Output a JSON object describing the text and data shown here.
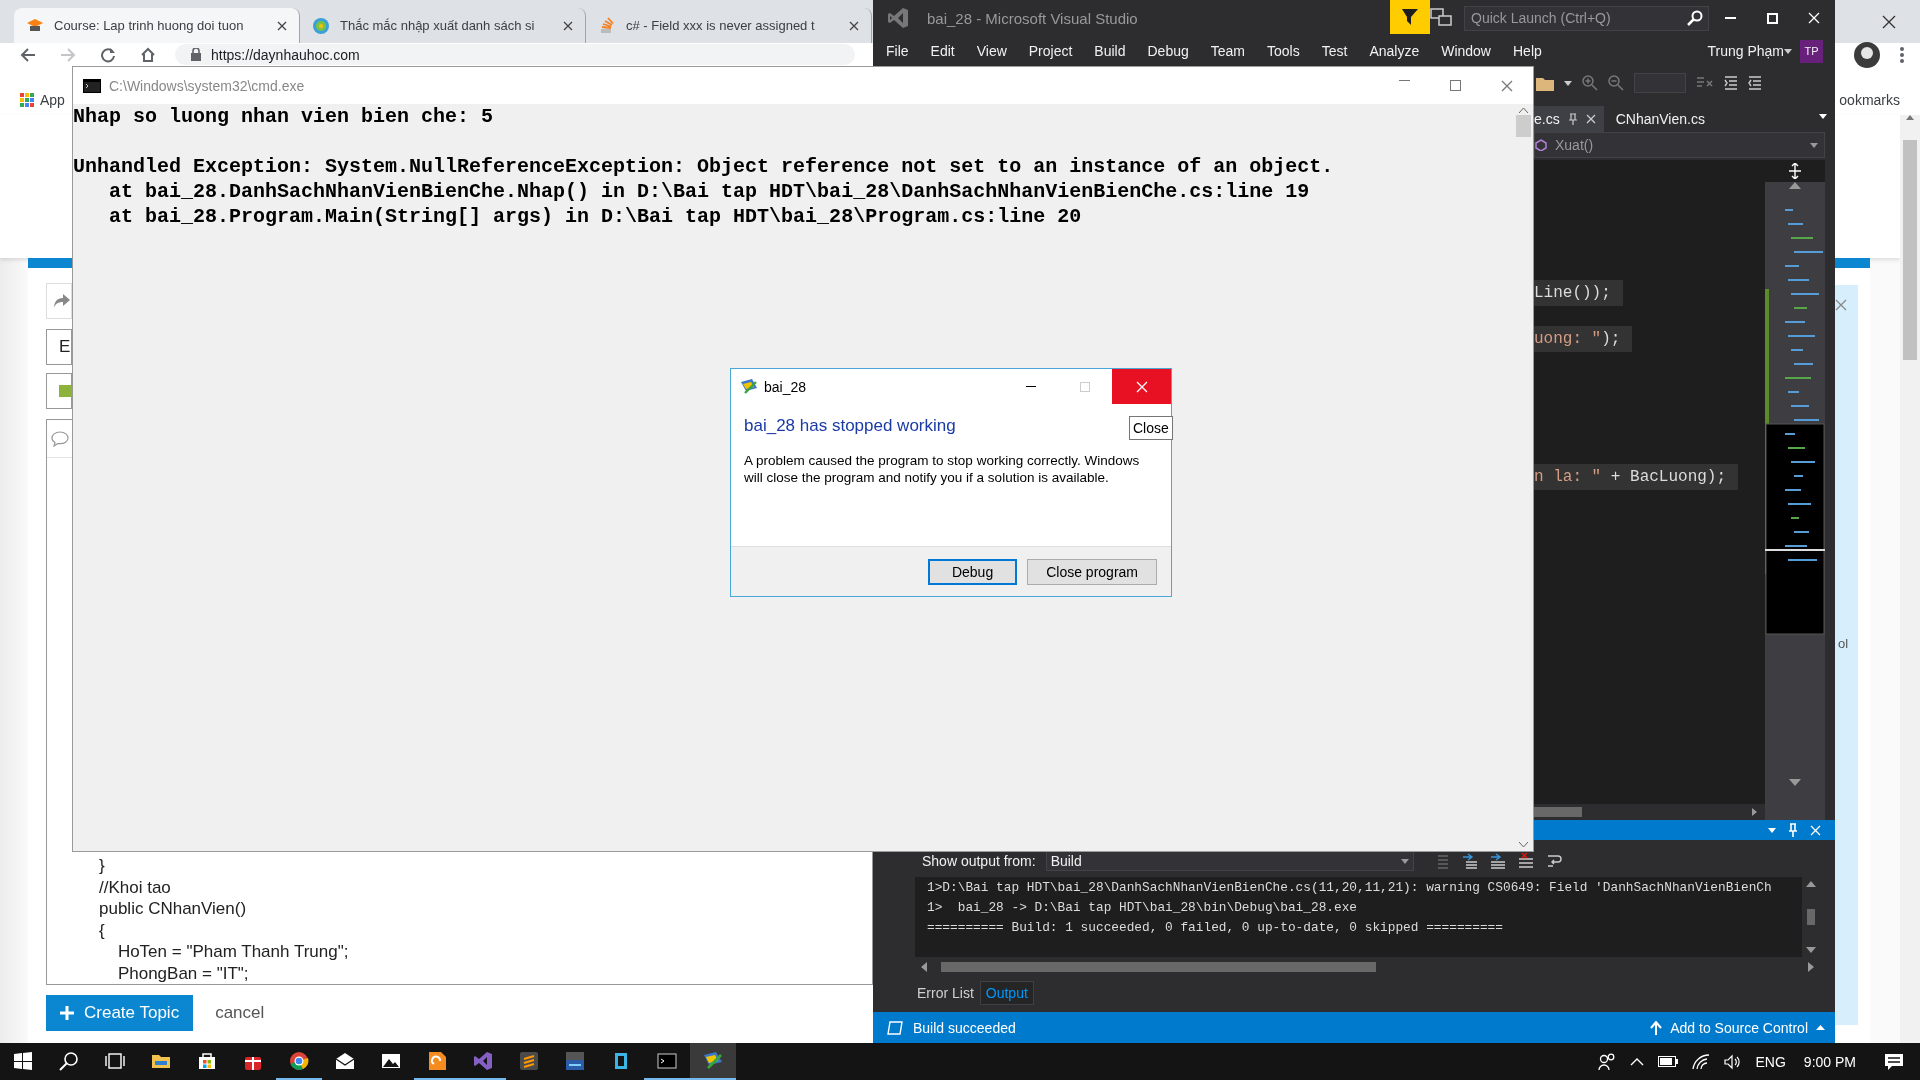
{
  "browser": {
    "tabs": [
      {
        "title": "Course: Lap trinh huong doi tuon",
        "selected": true
      },
      {
        "title": "Thắc mắc nhập xuất danh sách si",
        "selected": false
      },
      {
        "title": "c# - Field xxx is never assigned t",
        "selected": false
      }
    ],
    "address": "https://daynhauhoc.com",
    "bookmarks": [
      "App"
    ],
    "other_bookmarks": "ookmarks",
    "form": {
      "field_value": "E",
      "editor_lines": [
        "}",
        "//Khoi tao",
        "public CNhanVien()",
        "{",
        "    HoTen = \"Pham Thanh Trung\";",
        "    PhongBan = \"IT\";"
      ]
    },
    "side_panel_text": "ol",
    "buttons": [
      {
        "label": "Create Topic",
        "kind": "primary"
      },
      {
        "label": "cancel",
        "kind": "link"
      }
    ]
  },
  "visual_studio": {
    "title": "bai_28 - Microsoft Visual Studio",
    "quick_launch": {
      "placeholder": "Quick Launch (Ctrl+Q)"
    },
    "menu": [
      "File",
      "Edit",
      "View",
      "Project",
      "Build",
      "Debug",
      "Team",
      "Tools",
      "Test",
      "Analyze",
      "Window",
      "Help"
    ],
    "user": "Trung Phạm",
    "avatar": "TP",
    "doc_tabs": [
      {
        "label": "e.cs",
        "selected": true
      },
      {
        "label": "CNhanVien.cs",
        "selected": false
      }
    ],
    "navigation": "Xuat()",
    "code_lines": [
      [
        {
          "text": "Line());",
          "kind": "plain"
        }
      ],
      [
        {
          "text": "uong: \"",
          "kind": "string"
        },
        {
          "text": ");",
          "kind": "plain"
        }
      ],
      [
        {
          "text": "n la: \"",
          "kind": "string"
        },
        {
          "text": " + BacLuong);",
          "kind": "plain"
        }
      ]
    ],
    "output": {
      "label": "Show output from:",
      "source": "Build",
      "lines": [
        "1>D:\\Bai tap HDT\\bai_28\\DanhSachNhanVienBienChe.cs(11,20,11,21): warning CS0649: Field 'DanhSachNhanVienBienCh",
        "1>  bai_28 -> D:\\Bai tap HDT\\bai_28\\bin\\Debug\\bai_28.exe",
        "========== Build: 1 succeeded, 0 failed, 0 up-to-date, 0 skipped =========="
      ]
    },
    "panel_tabs": [
      {
        "label": "Error List",
        "selected": false
      },
      {
        "label": "Output",
        "selected": true
      }
    ],
    "status": "Build succeeded",
    "source_control": "Add to Source Control"
  },
  "console": {
    "title": "C:\\Windows\\system32\\cmd.exe",
    "blocks": [
      [
        "Nhap so luong nhan vien bien che: 5"
      ],
      [
        "Unhandled Exception: System.NullReferenceException: Object reference not set to an instance of an object.",
        "   at bai_28.DanhSachNhanVienBienChe.Nhap() in D:\\Bai tap HDT\\bai_28\\DanhSachNhanVienBienChe.cs:line 19",
        "   at bai_28.Program.Main(String[] args) in D:\\Bai tap HDT\\bai_28\\Program.cs:line 20"
      ]
    ]
  },
  "dialog": {
    "title": "bai_28",
    "tooltip": "Close",
    "heading": "bai_28 has stopped working",
    "message": "A problem caused the program to stop working correctly. Windows will close the program and notify you if a solution is available.",
    "buttons": [
      {
        "label": "Debug",
        "selected": true
      },
      {
        "label": "Close program",
        "selected": false
      }
    ]
  },
  "taskbar": {
    "apps": [
      {
        "kind": "start",
        "running": false,
        "active": false
      },
      {
        "kind": "search",
        "running": false,
        "active": false
      },
      {
        "kind": "taskview",
        "running": false,
        "active": false
      },
      {
        "kind": "explorer",
        "running": false,
        "active": false
      },
      {
        "kind": "store",
        "running": false,
        "active": false
      },
      {
        "kind": "gift",
        "running": false,
        "active": false
      },
      {
        "kind": "chrome",
        "running": true,
        "active": false
      },
      {
        "kind": "mail",
        "running": false,
        "active": false
      },
      {
        "kind": "photos",
        "running": false,
        "active": false
      },
      {
        "kind": "reader",
        "running": true,
        "active": false
      },
      {
        "kind": "vs",
        "running": true,
        "active": false
      },
      {
        "kind": "editor",
        "running": false,
        "active": false
      },
      {
        "kind": "ide",
        "running": false,
        "active": false
      },
      {
        "kind": "blocks",
        "running": false,
        "active": false
      },
      {
        "kind": "cmd",
        "running": true,
        "active": false
      },
      {
        "kind": "crash",
        "running": true,
        "active": true
      }
    ],
    "language": "ENG",
    "time": "9:00 PM"
  }
}
